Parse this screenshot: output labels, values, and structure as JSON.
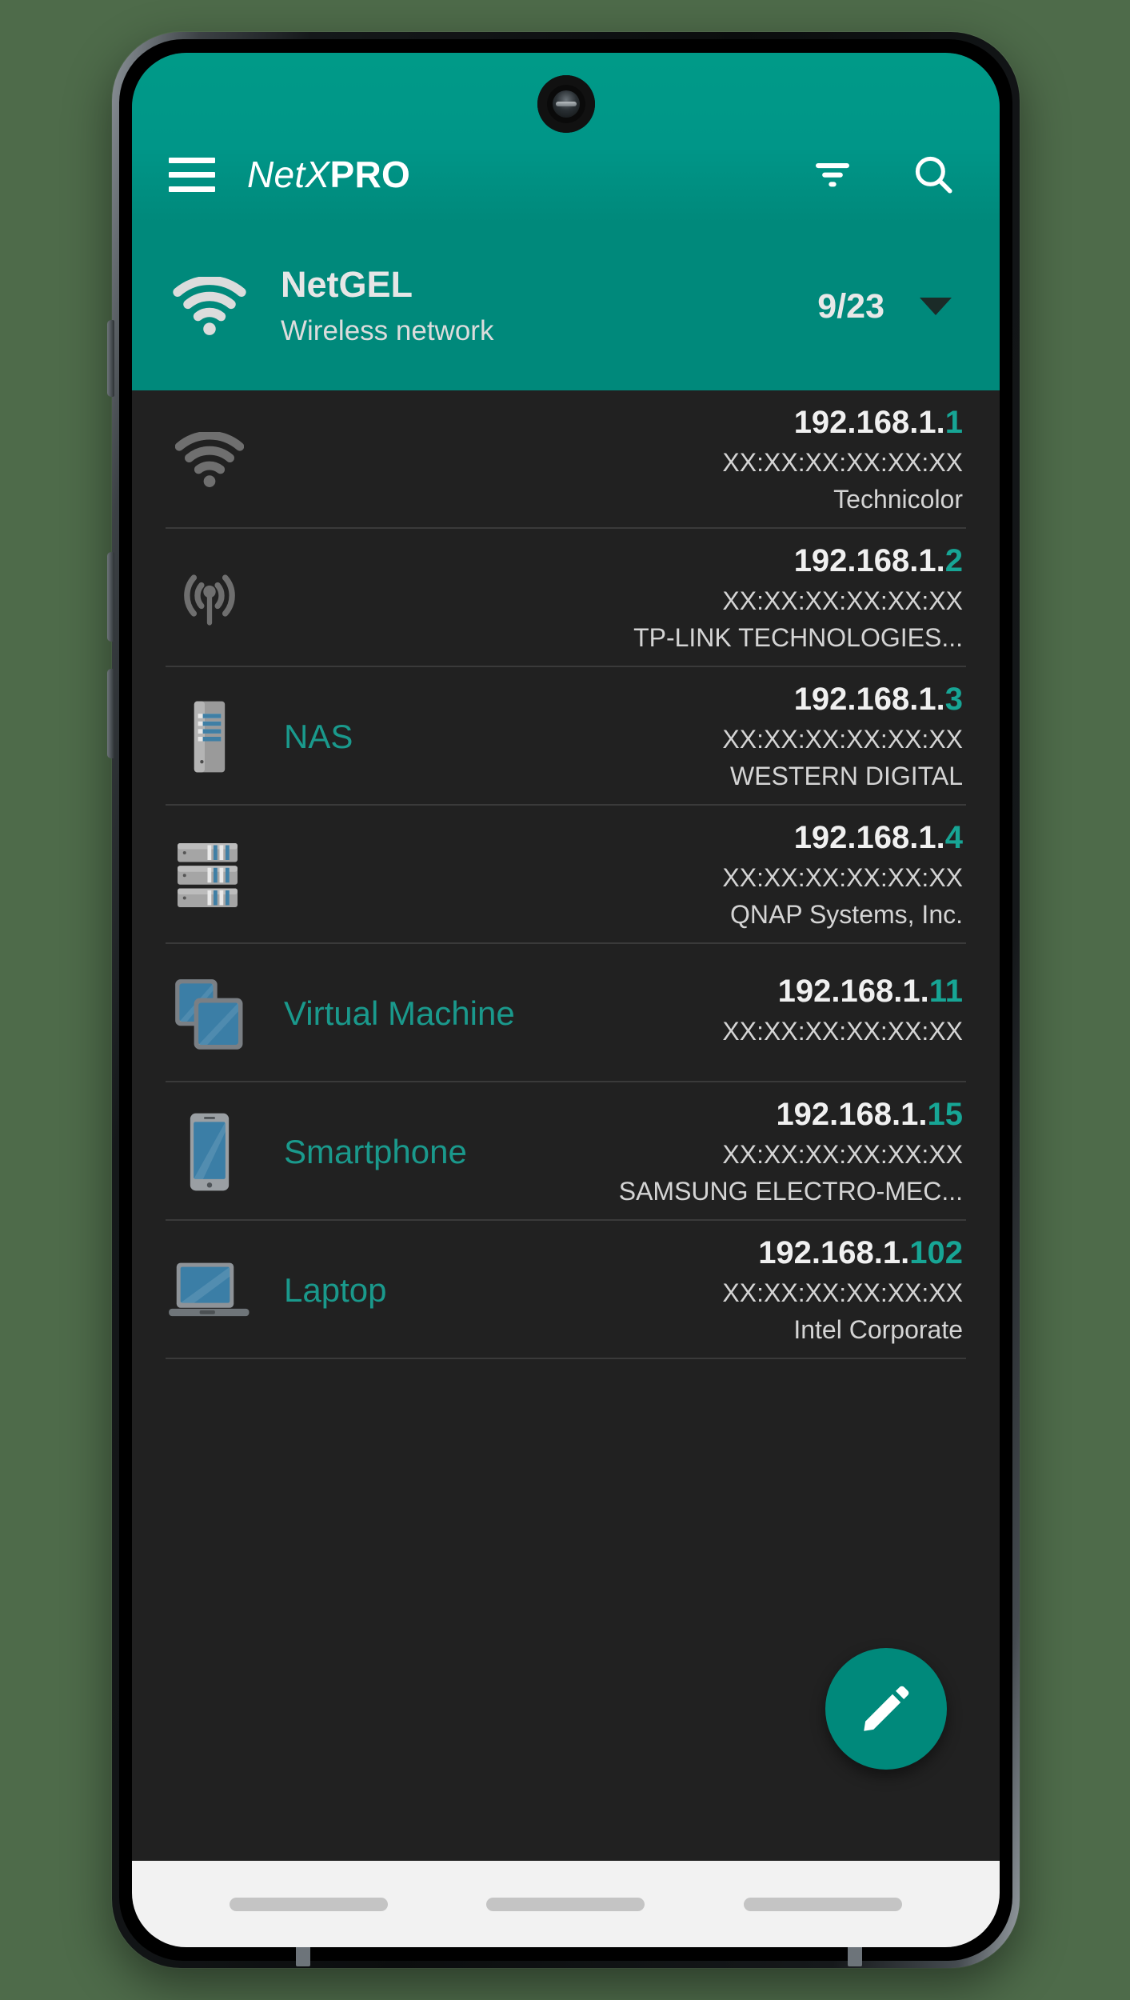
{
  "app": {
    "title_light": "NetX",
    "title_bold": "PRO",
    "menu_icon": "hamburger-menu-icon",
    "filter_icon": "filter-list-icon",
    "search_icon": "search-icon",
    "accent_color": "#009688",
    "accent_dark_color": "#00897b",
    "background_color": "#212121",
    "link_color": "#1a998c"
  },
  "network": {
    "icon": "wifi-icon",
    "name": "NetGEL",
    "subtitle": "Wireless network",
    "count": "9/23",
    "dropdown_icon": "chevron-down-icon"
  },
  "devices": [
    {
      "icon": "wifi-icon",
      "label": "",
      "ip_prefix": "192.168.1.",
      "ip_host": "1",
      "mac": "XX:XX:XX:XX:XX:XX",
      "vendor": "Technicolor"
    },
    {
      "icon": "access-point-icon",
      "label": "",
      "ip_prefix": "192.168.1.",
      "ip_host": "2",
      "mac": "XX:XX:XX:XX:XX:XX",
      "vendor": "TP-LINK TECHNOLOGIES..."
    },
    {
      "icon": "nas-tower-icon",
      "label": "NAS",
      "ip_prefix": "192.168.1.",
      "ip_host": "3",
      "mac": "XX:XX:XX:XX:XX:XX",
      "vendor": "WESTERN DIGITAL"
    },
    {
      "icon": "nas-rack-icon",
      "label": "",
      "ip_prefix": "192.168.1.",
      "ip_host": "4",
      "mac": "XX:XX:XX:XX:XX:XX",
      "vendor": "QNAP Systems, Inc."
    },
    {
      "icon": "virtual-machine-icon",
      "label": "Virtual Machine",
      "ip_prefix": "192.168.1.",
      "ip_host": "11",
      "mac": "XX:XX:XX:XX:XX:XX",
      "vendor": ""
    },
    {
      "icon": "smartphone-icon",
      "label": "Smartphone",
      "ip_prefix": "192.168.1.",
      "ip_host": "15",
      "mac": "XX:XX:XX:XX:XX:XX",
      "vendor": "SAMSUNG ELECTRO-MEC..."
    },
    {
      "icon": "laptop-icon",
      "label": "Laptop",
      "ip_prefix": "192.168.1.",
      "ip_host": "102",
      "mac": "XX:XX:XX:XX:XX:XX",
      "vendor": "Intel Corporate"
    }
  ],
  "fab": {
    "icon": "edit-pencil-icon"
  },
  "nav_bar": {
    "items": [
      {
        "name": "recents-button"
      },
      {
        "name": "home-button"
      },
      {
        "name": "back-button"
      }
    ]
  }
}
